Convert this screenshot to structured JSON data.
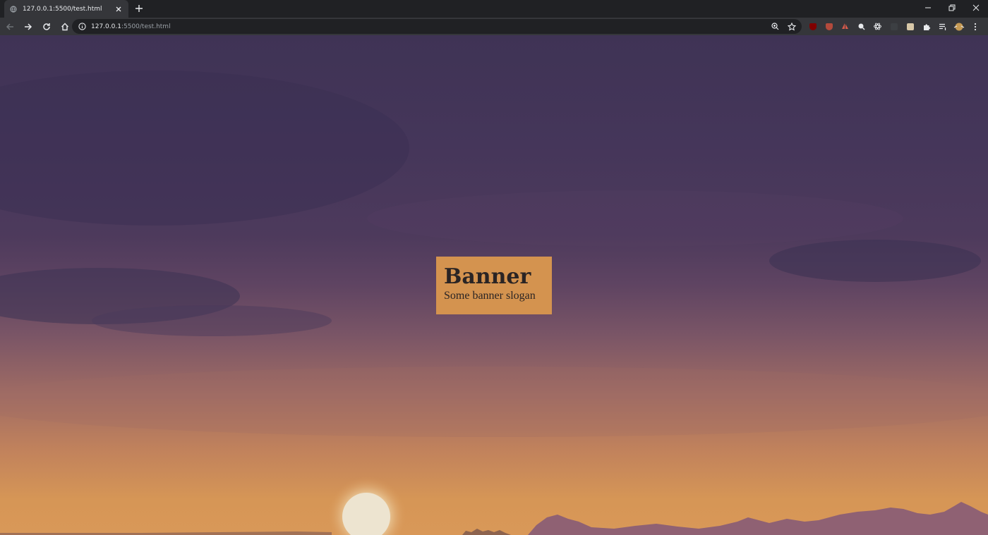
{
  "browser": {
    "tab": {
      "title": "127.0.0.1:5500/test.html"
    },
    "address_bar": {
      "host": "127.0.0.1",
      "rest": ":5500/test.html"
    }
  },
  "banner": {
    "title": "Banner",
    "slogan": "Some banner slogan"
  },
  "colors": {
    "banner_bg": "#d4934f",
    "sky_top": "#3f3355",
    "sky_bottom": "#d99858"
  }
}
